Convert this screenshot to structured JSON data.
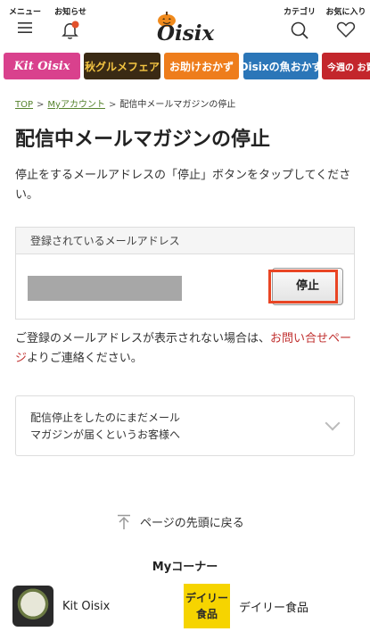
{
  "header": {
    "menu_label": "メニュー",
    "notifications_label": "お知らせ",
    "category_label": "カテゴリ",
    "favorites_label": "お気に入り",
    "logo_text": "Oisix"
  },
  "banners": [
    {
      "label": "Kit Oisix"
    },
    {
      "label": "秋グルメフェア"
    },
    {
      "label": "お助けおかず"
    },
    {
      "label": "Oisixの魚おかず"
    },
    {
      "label": "今週の お買い"
    }
  ],
  "breadcrumb": {
    "top": "TOP",
    "account": "Myアカウント",
    "current": "配信中メールマガジンの停止"
  },
  "page": {
    "title": "配信中メールマガジンの停止",
    "description": "停止をするメールアドレスの「停止」ボタンをタップしてください。"
  },
  "email_box": {
    "header": "登録されているメールアドレス",
    "stop_button": "停止"
  },
  "note": {
    "text": "ご登録のメールアドレスが表示されない場合は、",
    "link": "お問い合せページ",
    "suffix": "よりご連絡ください。"
  },
  "accordion": {
    "line1": "配信停止をしたのにまだメール",
    "line2": "マガジンが届くというお客様へ"
  },
  "back_to_top": "ページの先頭に戻る",
  "my_corner": {
    "title": "Myコーナー",
    "items": [
      {
        "label": "Kit Oisix"
      },
      {
        "label": "デイリー食品",
        "badge": "デイリー食品"
      }
    ]
  },
  "colors": {
    "accent_green": "#56832e",
    "link_red": "#c0302f",
    "highlight": "#e94524"
  }
}
